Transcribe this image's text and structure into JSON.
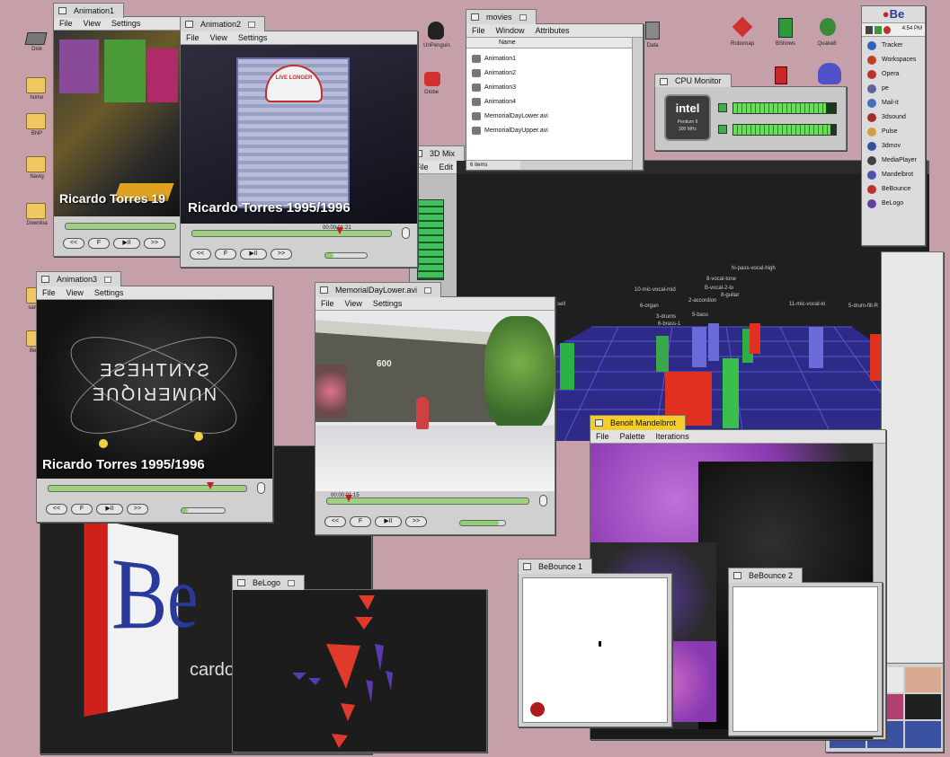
{
  "desktop": {
    "icons": [
      {
        "label": "Disk",
        "kind": "disk"
      },
      {
        "label": "home",
        "kind": "folder"
      },
      {
        "label": "BNP",
        "kind": "folder"
      },
      {
        "label": "Navig",
        "kind": "folder"
      },
      {
        "label": "Downloa",
        "kind": "folder"
      },
      {
        "label": "sample",
        "kind": "folder"
      },
      {
        "label": "BeOS",
        "kind": "folder"
      }
    ],
    "top_icons": [
      {
        "label": "UnPenguin"
      },
      {
        "label": "Globe"
      },
      {
        "label": "Data"
      },
      {
        "label": "Robomap"
      },
      {
        "label": "BShows"
      },
      {
        "label": "Quake8"
      }
    ]
  },
  "deskbar": {
    "logo": "Be",
    "clock": "4:54 PM",
    "items": [
      {
        "label": "Tracker",
        "color": "#3060c0"
      },
      {
        "label": "Workspaces",
        "color": "#c04020"
      },
      {
        "label": "Opera",
        "color": "#c03030"
      },
      {
        "label": "pe",
        "color": "#6060a0"
      },
      {
        "label": "Mail-it",
        "color": "#4070c0"
      },
      {
        "label": "3dsound",
        "color": "#a03030"
      },
      {
        "label": "Pulse",
        "color": "#d0a040"
      },
      {
        "label": "3dmov",
        "color": "#3050a0"
      },
      {
        "label": "MediaPlayer",
        "color": "#404040"
      },
      {
        "label": "Mandelbrot",
        "color": "#5050b0"
      },
      {
        "label": "BeBounce",
        "color": "#c03030"
      },
      {
        "label": "BeLogo",
        "color": "#6040a0"
      }
    ]
  },
  "windows": {
    "animation1": {
      "title": "Animation1",
      "menus": [
        "File",
        "View",
        "Settings"
      ],
      "caption": "Ricardo Torres 19"
    },
    "animation2": {
      "title": "Animation2",
      "menus": [
        "File",
        "View",
        "Settings"
      ],
      "caption": "Ricardo Torres 1995/1996",
      "sign": "LIVE LONGER",
      "timecode": "00:00:01:21",
      "progress": 0.55
    },
    "animation3": {
      "title": "Animation3",
      "menus": [
        "File",
        "View",
        "Settings"
      ],
      "caption": "Ricardo Torres 1995/1996",
      "art_top": "SYNTHESE",
      "art_bottom": "NUMERIQUE",
      "progress": 0.78
    },
    "memorial": {
      "title": "MemorialDayLower.avi",
      "menus": [
        "File",
        "View",
        "Settings"
      ],
      "sign": "600",
      "timecode": "00:00:01:15",
      "progress": 0.11
    },
    "movies": {
      "title": "movies",
      "menus": [
        "File",
        "Window",
        "Attributes"
      ],
      "column": "Name",
      "files": [
        "Animation1",
        "Animation2",
        "Animation3",
        "Animation4",
        "MemorialDayLower.avi",
        "MemorialDayUpper.avi"
      ],
      "status": "6 items"
    },
    "cpu": {
      "title": "CPU Monitor",
      "brand": "intel",
      "sub1": "Pentium II",
      "sub2": "300 MHz",
      "bars": [
        0.9,
        0.95
      ]
    },
    "mixer": {
      "title": "3D Mix",
      "menus": [
        "File",
        "Edit"
      ]
    },
    "mandelbrot": {
      "title": "Benoit Mandelbrot",
      "menus": [
        "File",
        "Palette",
        "Iterations"
      ]
    },
    "bebounce1": {
      "title": "BeBounce 1"
    },
    "bebounce2": {
      "title": "BeBounce 2"
    },
    "belogo": {
      "title": "BeLogo"
    },
    "belogo_bg": {
      "text": "Be",
      "caption": "cardo"
    },
    "animation1_tab": {
      "title": "Animation1"
    }
  },
  "scene3d": {
    "labels": [
      "hi-pass-vocal-high",
      "8-vocal-tone",
      "B-vocal-2-lo",
      "8-guitar",
      "10-mic-vocal-mid",
      "2-accordion",
      "11-mic-vocal-lo",
      "6-organ",
      "5-bass",
      "5-drum-fill-R",
      "3-drums",
      "6-brass-1",
      "sell"
    ]
  },
  "colors": {
    "desktop": "#c6a0a8",
    "tab_yellow": "#f4cc2c",
    "progress_green": "#9fd07f",
    "marker_red": "#c02020"
  }
}
